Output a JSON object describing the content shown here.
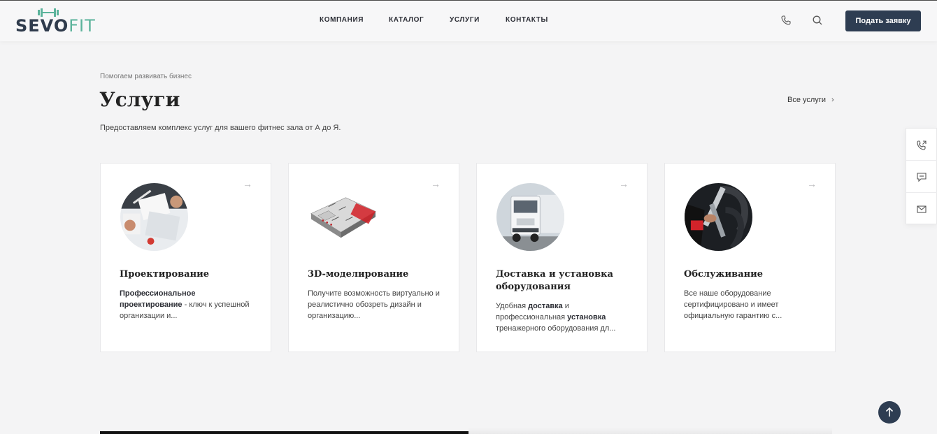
{
  "brand": {
    "logo_text_a": "SEVO",
    "logo_text_b": "FIT",
    "accent": "#5bb39b",
    "dark": "#2e3d52"
  },
  "nav": {
    "items": [
      "КОМПАНИЯ",
      "КАТАЛОГ",
      "УСЛУГИ",
      "КОНТАКТЫ"
    ]
  },
  "header": {
    "cta_label": "Подать заявку",
    "icons": [
      "phone-icon",
      "search-icon"
    ]
  },
  "section": {
    "eyebrow": "Помогаем развивать бизнес",
    "title": "Услуги",
    "subtitle": "Предоставляем комплекс услуг для вашего фитнес зала от А до Я.",
    "all_link": "Все услуги",
    "all_link_chevron": "›"
  },
  "cards": [
    {
      "title": "Проектирование",
      "arrow": "→",
      "desc_parts": [
        "Профессиональное проектирование",
        " - ключ к успешной организации и..."
      ]
    },
    {
      "title": "3D-моделирование",
      "arrow": "→",
      "desc": "Получите возможность виртуально и реалистично обозреть дизайн и организацию..."
    },
    {
      "title": "Доставка и установка оборудования",
      "arrow": "→",
      "desc_parts": [
        "Удобная ",
        "доставка",
        " и профессиональная ",
        "установка",
        " тренажерного оборудования дл..."
      ]
    },
    {
      "title": "Обслуживание",
      "arrow": "→",
      "desc": "Все наше оборудование сертифицировано и имеет официальную гарантию с..."
    }
  ],
  "side_widget": {
    "icons": [
      "callback-icon",
      "chat-icon",
      "mail-icon"
    ]
  },
  "scroll_top": {
    "icon": "arrow-up-icon"
  }
}
